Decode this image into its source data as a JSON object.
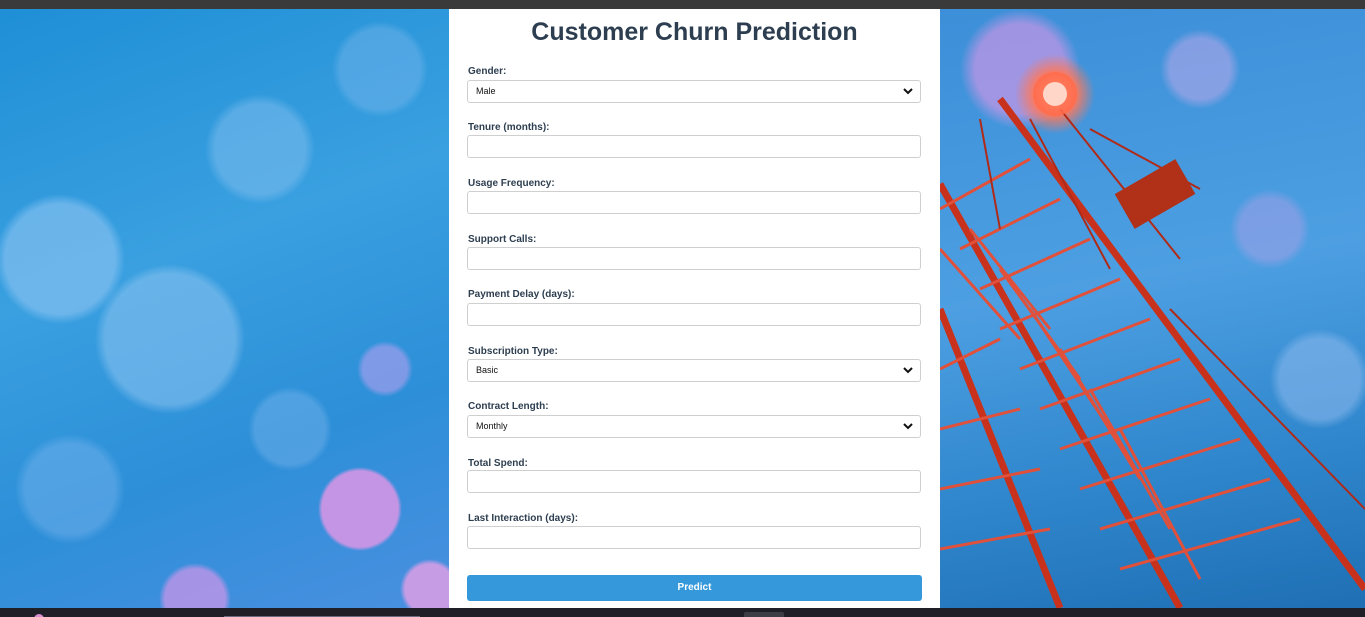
{
  "form": {
    "title": "Customer Churn Prediction",
    "fields": [
      {
        "label": "Gender:",
        "type": "select",
        "value": "Male"
      },
      {
        "label": "Tenure (months):",
        "type": "input",
        "value": ""
      },
      {
        "label": "Usage Frequency:",
        "type": "input",
        "value": ""
      },
      {
        "label": "Support Calls:",
        "type": "input",
        "value": ""
      },
      {
        "label": "Payment Delay (days):",
        "type": "input",
        "value": ""
      },
      {
        "label": "Subscription Type:",
        "type": "select",
        "value": "Basic"
      },
      {
        "label": "Contract Length:",
        "type": "select",
        "value": "Monthly"
      },
      {
        "label": "Total Spend:",
        "type": "input",
        "value": ""
      },
      {
        "label": "Last Interaction (days):",
        "type": "input",
        "value": ""
      }
    ],
    "submit_label": "Predict"
  },
  "icons": {
    "select_indicator": "chevron-down-icon"
  },
  "colors": {
    "title": "#2d3e50",
    "button": "#3498db",
    "panel": "#ffffff"
  }
}
